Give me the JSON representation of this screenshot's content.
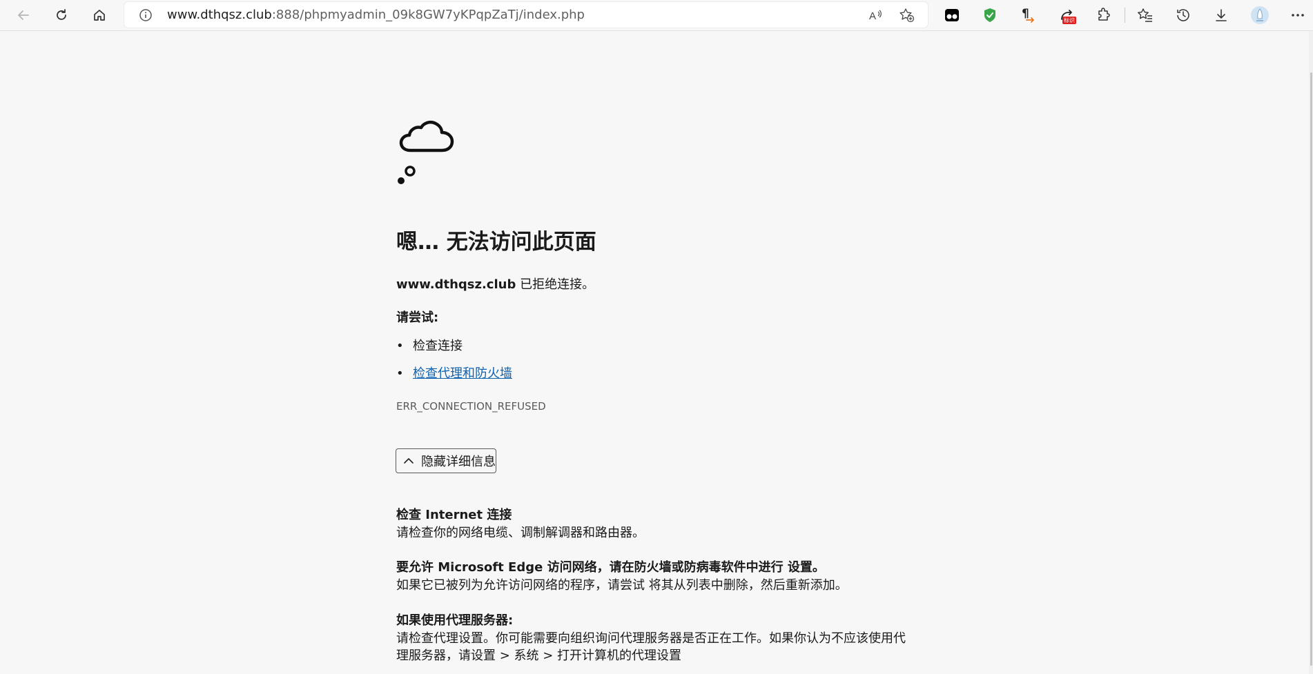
{
  "browser": {
    "address": {
      "host": "www.dthqsz.club",
      "rest": ":888/phpmyadmin_09k8GW7yKPqpZaTj/index.php"
    },
    "extension_badge": "标识"
  },
  "error_page": {
    "title": "嗯… 无法访问此页面",
    "message_host": "www.dthqsz.club",
    "message_suffix": " 已拒绝连接。",
    "try_label": "请尝试:",
    "suggestions": [
      {
        "text": "检查连接",
        "is_link": false
      },
      {
        "text": "检查代理和防火墙",
        "is_link": true
      }
    ],
    "error_code": "ERR_CONNECTION_REFUSED",
    "details_button": "隐藏详细信息",
    "details": [
      {
        "title": "检查 Internet 连接",
        "body": "请检查你的网络电缆、调制解调器和路由器。"
      },
      {
        "title": "要允许 Microsoft Edge 访问网络，请在防火墙或防病毒软件中进行 设置。",
        "body": "如果它已被列为允许访问网络的程序，请尝试 将其从列表中删除，然后重新添加。"
      },
      {
        "title": "如果使用代理服务器:",
        "body": "请检查代理设置。你可能需要向组织询问代理服务器是否正在工作。如果你认为不应该使用代理服务器，请设置 > 系统 > 打开计算机的代理设置"
      }
    ]
  }
}
